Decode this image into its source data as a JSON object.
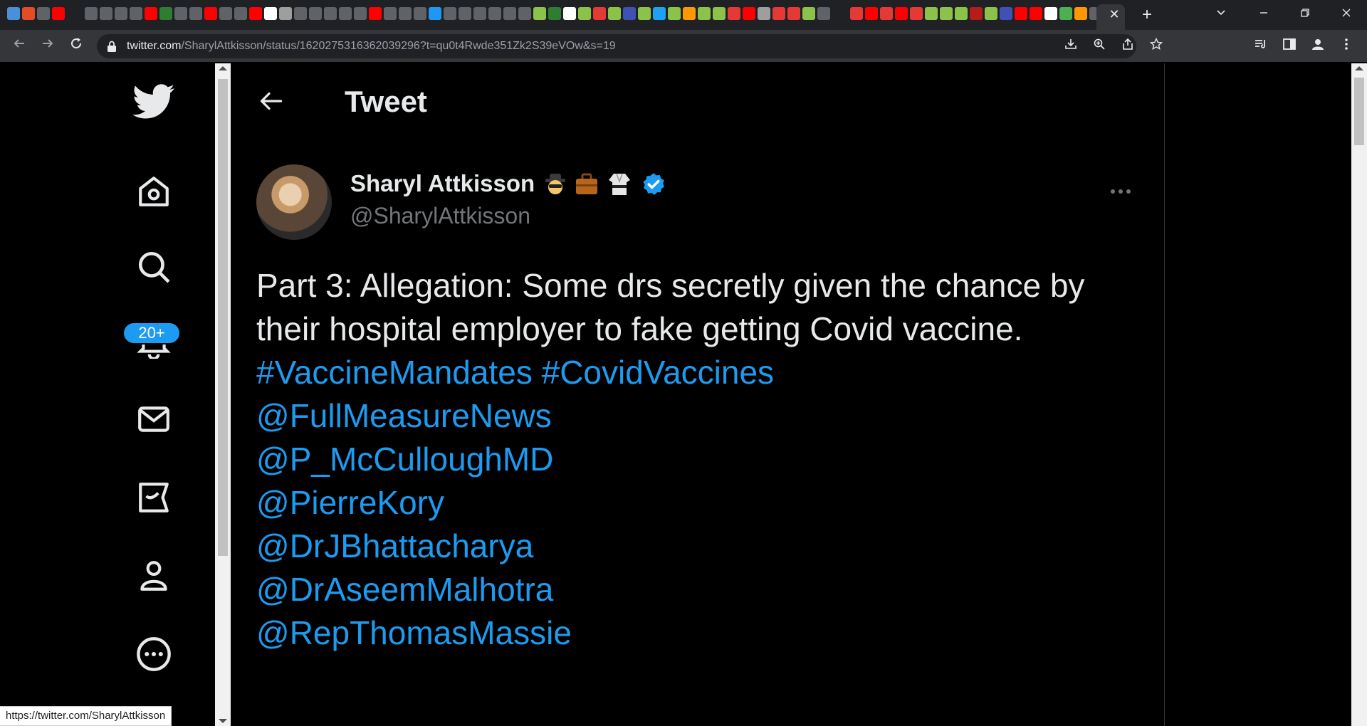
{
  "browser": {
    "tab_close_glyph": "✕",
    "new_tab_glyph": "+",
    "url_host": "twitter.com",
    "url_path": "/SharylAttkisson/status/1620275316362039296?t=qu0t4Rwde351Zk2S39eVOw&s=19",
    "status_url": "https://twitter.com/SharylAttkisson",
    "favicon_colors": [
      "#4a90d9",
      "#e34c26",
      "#5f6368",
      "#ff0000",
      "gap",
      "#5f6368",
      "#5f6368",
      "#5f6368",
      "#5f6368",
      "#ff0000",
      "#2e7d32",
      "#5f6368",
      "#5f6368",
      "#ff0000",
      "#5f6368",
      "#5f6368",
      "#ff0000",
      "#ffffff",
      "#9e9e9e",
      "#5f6368",
      "#5f6368",
      "#5f6368",
      "#5f6368",
      "#5f6368",
      "#ff0000",
      "#5f6368",
      "#5f6368",
      "#5f6368",
      "#2196f3",
      "#5f6368",
      "#5f6368",
      "#5f6368",
      "#5f6368",
      "#5f6368",
      "#5f6368",
      "#8bc34a",
      "#2e7d32",
      "#ffffff",
      "#8bc34a",
      "#e53935",
      "#8bc34a",
      "#3f51b5",
      "#8bc34a",
      "#1da1f2",
      "#8bc34a",
      "#ff9800",
      "#8bc34a",
      "#8bc34a",
      "#e53935",
      "#ff0000",
      "#9e9e9e",
      "#e53935",
      "#e53935",
      "#8bc34a",
      "#5f6368",
      "gap",
      "#e53935",
      "#ff0000",
      "#e53935",
      "#ff0000",
      "#e53935",
      "#8bc34a",
      "#8bc34a",
      "#8bc34a",
      "#b71c1c",
      "#8bc34a",
      "#3f51b5",
      "#ff0000",
      "#ff0000",
      "#ffffff",
      "#4caf50",
      "#ff9800",
      "#5f6368",
      "#9c27b0"
    ]
  },
  "nav": {
    "notifications_badge": "20+"
  },
  "header": {
    "title": "Tweet"
  },
  "tweet": {
    "display_name": "Sharyl Attkisson",
    "handle": "@SharylAttkisson",
    "text_plain": "Part 3: Allegation: Some drs secretly given the chance by their hospital employer to fake getting Covid vaccine.",
    "hashtags": "#VaccineMandates #CovidVaccines",
    "mentions": [
      "@FullMeasureNews",
      "@P_McCulloughMD",
      "@PierreKory",
      "@DrJBhattacharya",
      "@DrAseemMalhotra",
      "@RepThomasMassie"
    ]
  },
  "colors": {
    "accent": "#1d9bf0",
    "text": "#e7e9ea",
    "muted": "#71767b",
    "background": "#000000"
  }
}
